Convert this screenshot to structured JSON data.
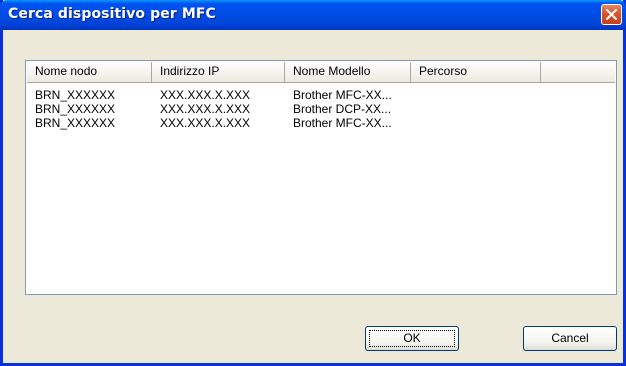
{
  "window": {
    "title": "Cerca dispositivo per MFC"
  },
  "list": {
    "columns": [
      "Nome nodo",
      "Indirizzo IP",
      "Nome Modello",
      "Percorso",
      ""
    ],
    "rows": [
      [
        "BRN_XXXXXX",
        "XXX.XXX.X.XXX",
        "Brother MFC-XX...",
        ""
      ],
      [
        "BRN_XXXXXX",
        "XXX.XXX.X.XXX",
        "Brother DCP-XX...",
        ""
      ],
      [
        "BRN_XXXXXX",
        "XXX.XXX.X.XXX",
        "Brother MFC-XX...",
        ""
      ]
    ]
  },
  "buttons": {
    "ok": "OK",
    "cancel": "Cancel"
  },
  "icons": {
    "close": "close-icon"
  },
  "colors": {
    "titlebar": "#0053ee",
    "close": "#d8542c",
    "background": "#ece9d8"
  }
}
